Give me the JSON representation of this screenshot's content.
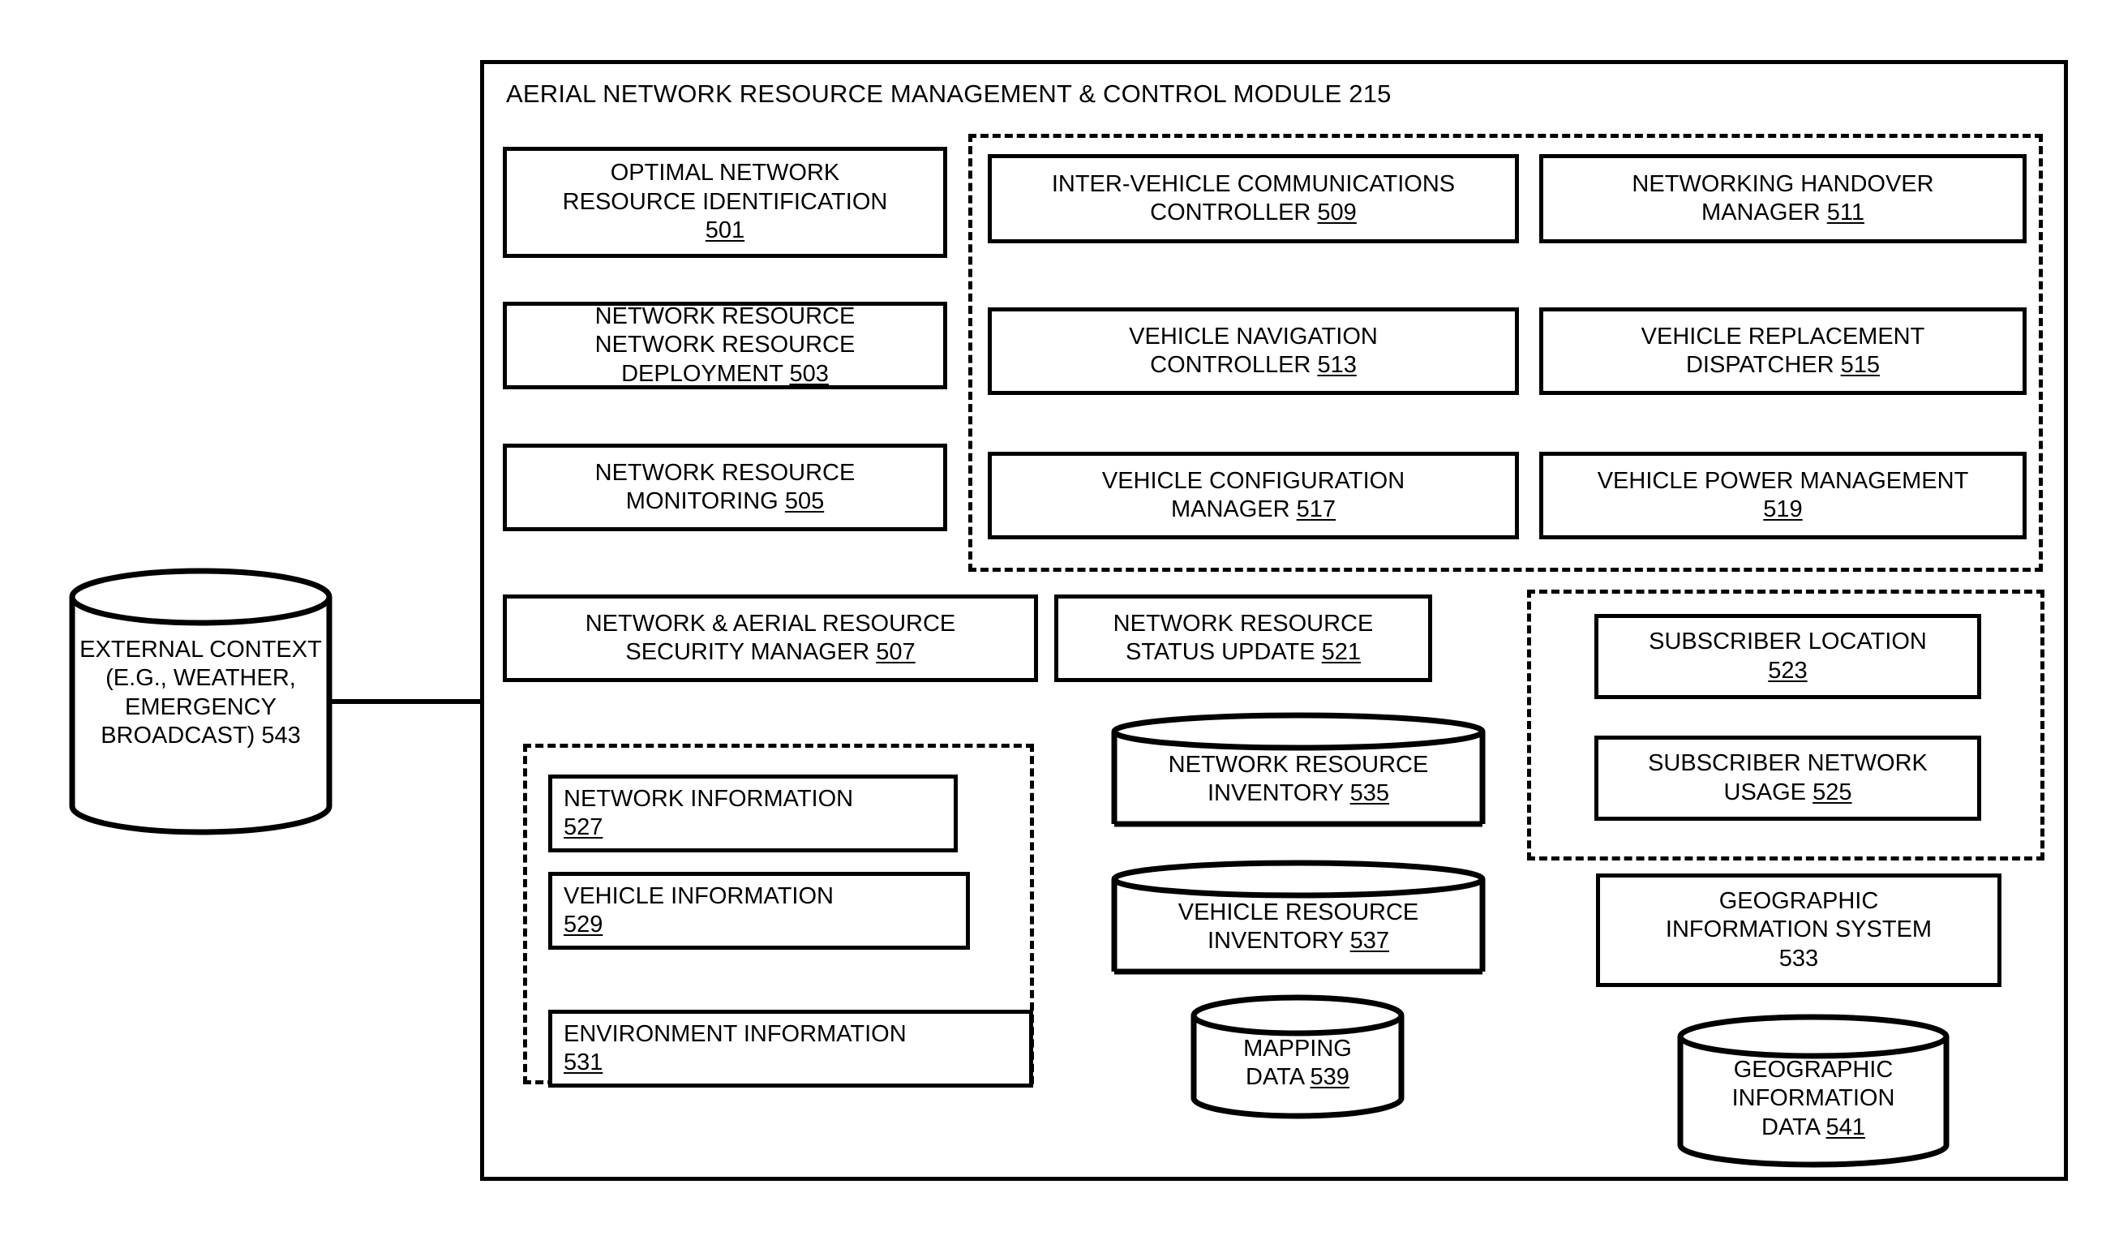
{
  "diagram": {
    "title": "AERIAL NETWORK RESOURCE MANAGEMENT & CONTROL MODULE 215",
    "module_title_text": "AERIAL NETWORK RESOURCE MANAGEMENT & CONTROL MODULE",
    "module_ref": "215"
  },
  "external": {
    "line1": "EXTERNAL CONTEXT",
    "line2": "(E.G., WEATHER,",
    "line3": "EMERGENCY",
    "line4": "BROADCAST) 543"
  },
  "left_column": [
    {
      "line1": "OPTIMAL NETWORK",
      "line2": "RESOURCE IDENTIFICATION",
      "line3": "501",
      "ref": "501"
    },
    {
      "line1": "NETWORK RESOURCE",
      "line2": "DEPLOYMENT 503",
      "ref": "503"
    },
    {
      "line1": "NETWORK RESOURCE",
      "line2": "MONITORING 505",
      "ref": "505"
    }
  ],
  "vehicle_group": {
    "middle": [
      {
        "line1": "INTER-VEHICLE COMMUNICATIONS",
        "line2": "CONTROLLER 509",
        "ref": "509"
      },
      {
        "line1": "VEHICLE NAVIGATION",
        "line2": "CONTROLLER 513",
        "ref": "513"
      },
      {
        "line1": "VEHICLE CONFIGURATION",
        "line2": "MANAGER 517",
        "ref": "517"
      }
    ],
    "right": [
      {
        "line1": "NETWORKING HANDOVER",
        "line2": "MANAGER 511",
        "ref": "511"
      },
      {
        "line1": "VEHICLE REPLACEMENT",
        "line2": "DISPATCHER 515",
        "ref": "515"
      },
      {
        "line1": "VEHICLE POWER MANAGEMENT",
        "line2": "519",
        "ref": "519"
      }
    ]
  },
  "security_manager": {
    "line1": "NETWORK & AERIAL RESOURCE",
    "line2": "SECURITY MANAGER 507",
    "ref": "507"
  },
  "status_update": {
    "line1": "NETWORK RESOURCE",
    "line2": "STATUS UPDATE 521",
    "ref": "521"
  },
  "subscriber_group": [
    {
      "line1": "SUBSCRIBER LOCATION",
      "line2": "523",
      "ref": "523"
    },
    {
      "line1": "SUBSCRIBER NETWORK",
      "line2": "USAGE 525",
      "ref": "525"
    }
  ],
  "information_group": [
    {
      "line1": "NETWORK INFORMATION",
      "line2": "527",
      "ref": "527"
    },
    {
      "line1": "VEHICLE INFORMATION",
      "line2": "529",
      "ref": "529"
    },
    {
      "line1": "ENVIRONMENT INFORMATION",
      "line2": "531",
      "ref": "531"
    }
  ],
  "gis_box": {
    "line1": "GEOGRAPHIC",
    "line2": "INFORMATION SYSTEM",
    "line3": "533"
  },
  "databases": [
    {
      "name": "network-resource-inventory",
      "line1": "NETWORK RESOURCE",
      "line2": "INVENTORY 535",
      "ref": "535"
    },
    {
      "name": "vehicle-resource-inventory",
      "line1": "VEHICLE RESOURCE",
      "line2": "INVENTORY 537",
      "ref": "537"
    },
    {
      "name": "mapping-data",
      "line1": "MAPPING",
      "line2": "DATA 539",
      "ref": "539"
    },
    {
      "name": "geographic-information-data",
      "line1": "GEOGRAPHIC",
      "line2": "INFORMATION",
      "line3": "DATA 541",
      "ref": "541"
    }
  ],
  "colors": {
    "stroke": "#000000",
    "background": "#ffffff"
  }
}
